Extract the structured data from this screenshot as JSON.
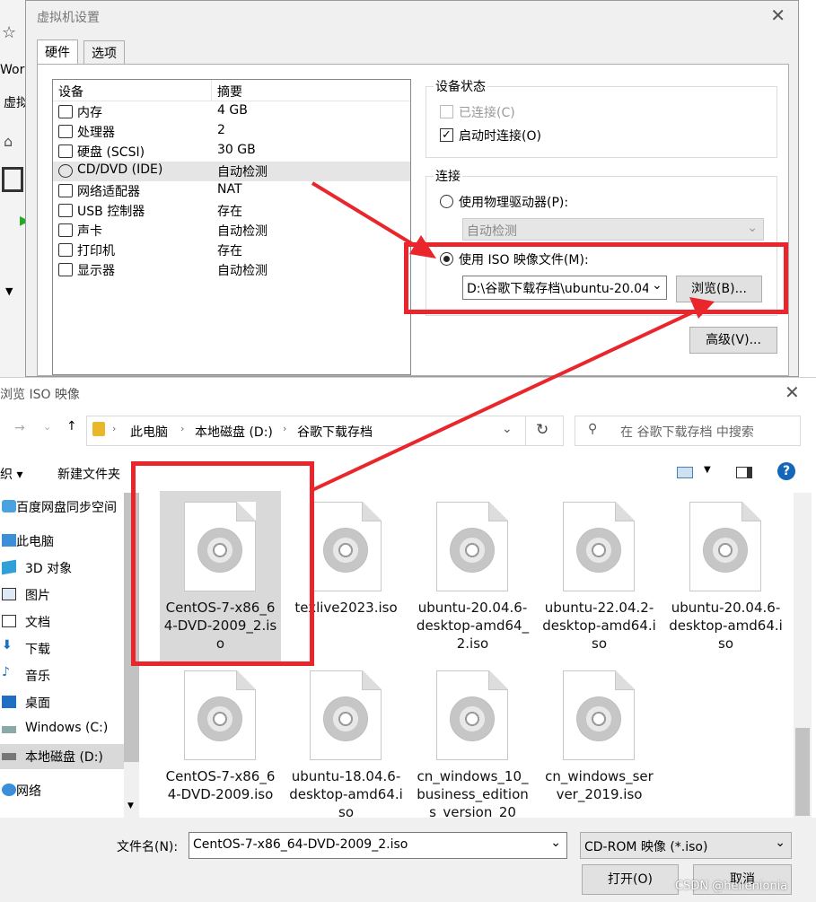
{
  "background_fragments": [
    "Works",
    "虚拟"
  ],
  "vm_settings": {
    "title": "虚拟机设置",
    "tabs": [
      "硬件",
      "选项"
    ],
    "device_list": {
      "headers": [
        "设备",
        "摘要"
      ],
      "rows": [
        {
          "name": "内存",
          "summary": "4 GB",
          "icon": "memory-icon"
        },
        {
          "name": "处理器",
          "summary": "2",
          "icon": "cpu-icon"
        },
        {
          "name": "硬盘 (SCSI)",
          "summary": "30 GB",
          "icon": "harddisk-icon"
        },
        {
          "name": "CD/DVD (IDE)",
          "summary": "自动检测",
          "icon": "cdrom-icon"
        },
        {
          "name": "网络适配器",
          "summary": "NAT",
          "icon": "network-icon"
        },
        {
          "name": "USB 控制器",
          "summary": "存在",
          "icon": "usb-icon"
        },
        {
          "name": "声卡",
          "summary": "自动检测",
          "icon": "speaker-icon"
        },
        {
          "name": "打印机",
          "summary": "存在",
          "icon": "printer-icon"
        },
        {
          "name": "显示器",
          "summary": "自动检测",
          "icon": "monitor-icon"
        }
      ]
    },
    "device_status": {
      "group_label": "设备状态",
      "connected_label": "已连接(C)",
      "connect_on_start_label": "启动时连接(O)"
    },
    "connection": {
      "group_label": "连接",
      "physical_label": "使用物理驱动器(P):",
      "physical_value": "自动检测",
      "iso_label": "使用 ISO 映像文件(M):",
      "iso_value": "D:\\谷歌下载存档\\ubuntu-20.04",
      "browse_label": "浏览(B)...",
      "advanced_label": "高级(V)..."
    }
  },
  "file_dialog": {
    "title": "浏览 ISO 映像",
    "breadcrumb": [
      "此电脑",
      "本地磁盘 (D:)",
      "谷歌下载存档"
    ],
    "search_placeholder": "在 谷歌下载存档 中搜索",
    "toolbar": {
      "organize_label": "织 ▾",
      "new_folder_label": "新建文件夹"
    },
    "nav_items": [
      {
        "label": "百度网盘同步空间",
        "icon": "cloud-icon"
      },
      {
        "label": "此电脑",
        "icon": "computer-icon"
      },
      {
        "label": "3D 对象",
        "icon": "cube-icon"
      },
      {
        "label": "图片",
        "icon": "picture-icon"
      },
      {
        "label": "文档",
        "icon": "document-icon"
      },
      {
        "label": "下载",
        "icon": "download-icon"
      },
      {
        "label": "音乐",
        "icon": "music-icon"
      },
      {
        "label": "桌面",
        "icon": "desktop-icon"
      },
      {
        "label": "Windows (C:)",
        "icon": "drive-icon"
      },
      {
        "label": "本地磁盘 (D:)",
        "icon": "drive-icon"
      },
      {
        "label": "网络",
        "icon": "network-icon"
      }
    ],
    "files": [
      "CentOS-7-x86_64-DVD-2009_2.iso",
      "texlive2023.iso",
      "ubuntu-20.04.6-desktop-amd64_2.iso",
      "ubuntu-22.04.2-desktop-amd64.iso",
      "ubuntu-20.04.6-desktop-amd64.iso",
      "CentOS-7-x86_64-DVD-2009.iso",
      "ubuntu-18.04.6-desktop-amd64.iso",
      "cn_windows_10_business_editions_version_20",
      "cn_windows_server_2019.iso"
    ],
    "filename_label": "文件名(N):",
    "filename_value": "CentOS-7-x86_64-DVD-2009_2.iso",
    "filetype_value": "CD-ROM 映像 (*.iso)",
    "open_label": "打开(O)",
    "cancel_label": "取消"
  },
  "watermark": "CSDN @hellenionia",
  "colors": {
    "highlight_red": "#e8262b",
    "selection": "#cce8ff"
  }
}
